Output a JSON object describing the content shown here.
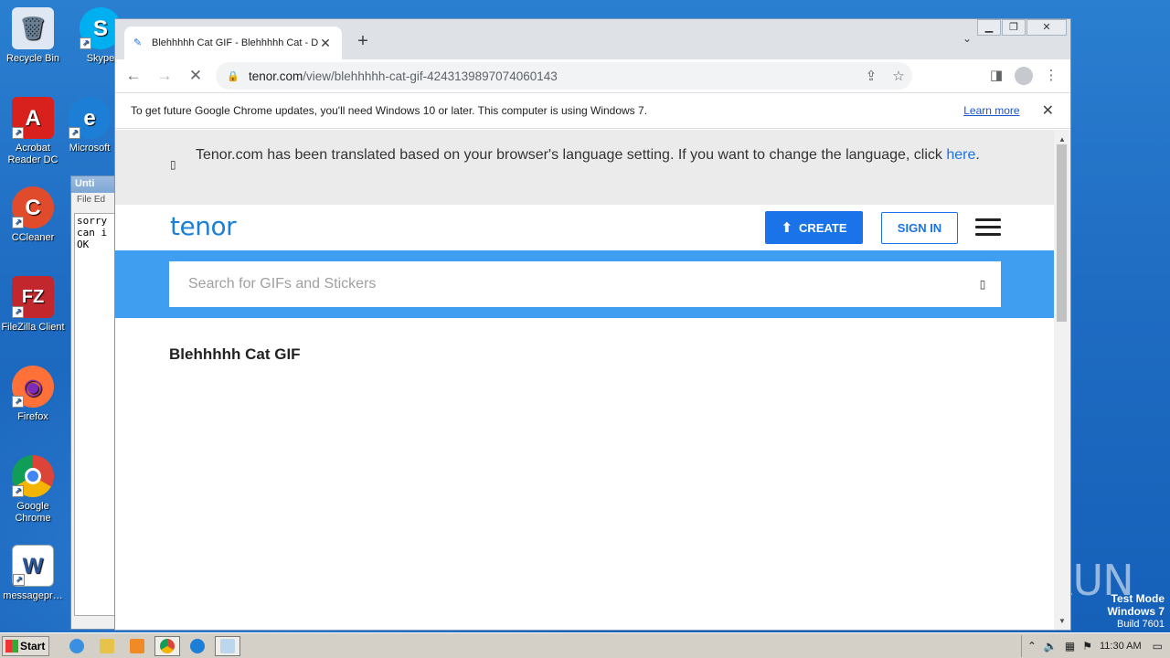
{
  "desktop": {
    "icons": [
      {
        "label": "Recycle Bin",
        "glyph": "🗑",
        "bg": "#dfe8f2"
      },
      {
        "label": "Skype",
        "glyph": "S",
        "bg": "#00aff0"
      },
      {
        "label": "Acrobat Reader DC",
        "glyph": "A",
        "bg": "#d8201d"
      },
      {
        "label": "Microsoft",
        "glyph": "e",
        "bg": "#1d7ed6"
      },
      {
        "label": "CCleaner",
        "glyph": "C",
        "bg": "#e04b2b"
      },
      {
        "label": "FileZilla Client",
        "glyph": "FZ",
        "bg": "#c1272d"
      },
      {
        "label": "Firefox",
        "glyph": "◉",
        "bg": "#ff7139"
      },
      {
        "label": "Google Chrome",
        "glyph": "◉",
        "bg": "#e9ecef"
      },
      {
        "label": "messagepr…",
        "glyph": "W",
        "bg": "#ffffff"
      }
    ]
  },
  "notepad": {
    "title": "Unti",
    "menu": "File  Ed",
    "text": "sorry\ncan i\nOK"
  },
  "browser": {
    "tab": {
      "title": "Blehhhhh Cat GIF - Blehhhhh Cat - D",
      "favicon": "pen-icon"
    },
    "new_tab": "+",
    "url_host": "tenor.com",
    "url_path": "/view/blehhhhh-cat-gif-4243139897074060143",
    "infobar": {
      "message": "To get future Google Chrome updates, you'll need Windows 10 or later. This computer is using Windows 7.",
      "link": "Learn more"
    }
  },
  "page": {
    "translate_banner": {
      "text": "Tenor.com has been translated based on your browser's language setting. If you want to change the language, click ",
      "link": "here",
      "suffix": "."
    },
    "logo": "tenor",
    "create_label": "CREATE",
    "signin_label": "SIGN IN",
    "search_placeholder": "Search for GIFs and Stickers",
    "gif_title": "Blehhhhh Cat GIF"
  },
  "overlay": {
    "watermark": "ANY RUN",
    "test_mode": [
      "Test Mode",
      "Windows 7",
      "Build 7601"
    ]
  },
  "taskbar": {
    "start_label": "Start",
    "clock": "11:30 AM"
  },
  "colors": {
    "tenor_blue": "#1a73e8",
    "search_band": "#3f9ef0",
    "desktop": "#1f6cc3"
  }
}
